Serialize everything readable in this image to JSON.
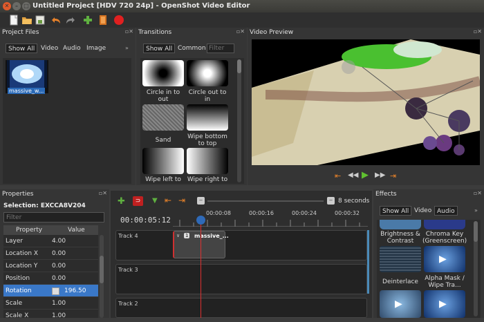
{
  "window": {
    "title": "Untitled Project [HDV 720 24p] - OpenShot Video Editor"
  },
  "toolbar": {
    "icons": [
      "new-project-icon",
      "open-project-icon",
      "save-project-icon",
      "undo-icon",
      "redo-icon",
      "import-files-icon",
      "choose-profile-icon",
      "export-video-icon"
    ]
  },
  "project_files": {
    "title": "Project Files",
    "filters": [
      "Show All",
      "Video",
      "Audio",
      "Image"
    ],
    "items": [
      {
        "label": "massive_w..."
      }
    ]
  },
  "transitions": {
    "title": "Transitions",
    "filters": [
      "Show All",
      "Common"
    ],
    "filter_placeholder": "Filter",
    "items": [
      {
        "label": "Circle in to out"
      },
      {
        "label": "Circle out to in"
      },
      {
        "label": "Sand"
      },
      {
        "label": "Wipe bottom to top"
      },
      {
        "label": "Wipe left to"
      },
      {
        "label": "Wipe right to"
      }
    ]
  },
  "preview": {
    "title": "Video Preview"
  },
  "properties": {
    "title": "Properties",
    "selection": "Selection: EXCCA8V204",
    "filter_placeholder": "Filter",
    "col_property": "Property",
    "col_value": "Value",
    "rows": [
      {
        "name": "Layer",
        "value": "4.00"
      },
      {
        "name": "Location X",
        "value": "0.00"
      },
      {
        "name": "Location Y",
        "value": "0.00"
      },
      {
        "name": "Position",
        "value": "0.00"
      },
      {
        "name": "Rotation",
        "value": "196.50",
        "selected": true
      },
      {
        "name": "Scale",
        "value": "1.00"
      },
      {
        "name": "Scale X",
        "value": "1.00"
      }
    ]
  },
  "timeline": {
    "zoom_label": "8 seconds",
    "timecode": "00:00:05:12",
    "ruler": [
      "00:00:08",
      "00:00:16",
      "00:00:24",
      "00:00:32"
    ],
    "tracks": [
      "Track 4",
      "Track 3",
      "Track 2"
    ],
    "clip": {
      "number": "1",
      "label": "massive_..."
    }
  },
  "effects": {
    "title": "Effects",
    "filters": [
      "Show All",
      "Video",
      "Audio"
    ],
    "items": [
      {
        "label": "Brightness & Contrast"
      },
      {
        "label": "Chroma Key (Greenscreen)"
      },
      {
        "label": "Deinterlace"
      },
      {
        "label": "Alpha Mask / Wipe Tra..."
      }
    ]
  },
  "colors": {
    "accent": "#2f80d0",
    "playhead": "#e03030",
    "selected_row": "#3a78c8"
  }
}
